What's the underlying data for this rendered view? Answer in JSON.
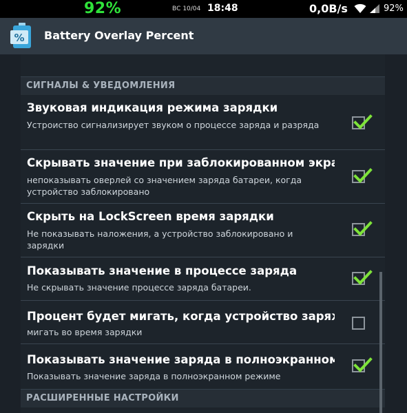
{
  "status_bar": {
    "battery_overlay": "92%",
    "date": "ВС 10/04",
    "time": "18:48",
    "network_speed": "0,0B/s",
    "battery_percent": "92%"
  },
  "action_bar": {
    "title": "Battery Overlay Percent",
    "icon": "battery-percent-icon"
  },
  "sections": [
    {
      "header": "СИГНАЛЫ & УВЕДОМЛЕНИЯ"
    },
    {
      "header": "РАСШИРЕННЫЕ НАСТРОЙКИ"
    }
  ],
  "preferences": [
    {
      "title": "Звуковая индикация режима зарядки",
      "summary": "Устроиство сигнализирует звуком о процессе заряда и разряда",
      "checked": true
    },
    {
      "title": "Скрывать значение при заблокированном экране",
      "summary": "непоказывать оверлей со значением заряда батареи, когда устройство заблокировано",
      "checked": true
    },
    {
      "title": "Скрыть на LockScreen время зарядки",
      "summary": "Не показывать наложения, а устройство заблокировано и зарядки",
      "checked": true
    },
    {
      "title": "Показывать значение в процессе заряда",
      "summary": "Не скрывать значение процессе заряда батареи.",
      "checked": true
    },
    {
      "title": "Процент будет мигать, когда устройство заряжается",
      "summary": "мигать во время зарядки",
      "checked": false
    },
    {
      "title": "Показывать значение заряда в полноэкранном режиме",
      "summary": "Показывать значение заряда в полноэкранном режиме",
      "checked": true
    }
  ],
  "colors": {
    "check_green": "#7ee33a",
    "overlay_green": "#2fe23a"
  }
}
